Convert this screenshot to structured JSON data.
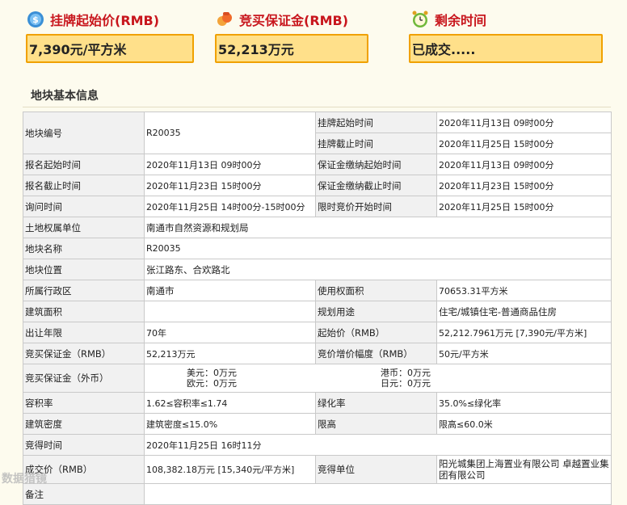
{
  "header": {
    "start_price_label": "挂牌起始价(RMB)",
    "deposit_label": "竞买保证金(RMB)",
    "time_left_label": "剩余时间",
    "start_price_value": "7,390元/平方米",
    "deposit_value": "52,213万元",
    "time_left_value": "已成交....."
  },
  "section": {
    "title": "地块基本信息"
  },
  "table": {
    "r1": {
      "k1": "地块编号",
      "v1": "R20035",
      "k2a": "挂牌起始时间",
      "v2a": "2020年11月13日 09时00分",
      "k2b": "挂牌截止时间",
      "v2b": "2020年11月25日 15时00分"
    },
    "r2": {
      "k1": "报名起始时间",
      "v1": "2020年11月13日 09时00分",
      "k2": "保证金缴纳起始时间",
      "v2": "2020年11月13日 09时00分"
    },
    "r3": {
      "k1": "报名截止时间",
      "v1": "2020年11月23日 15时00分",
      "k2": "保证金缴纳截止时间",
      "v2": "2020年11月23日 15时00分"
    },
    "r4": {
      "k1": "询问时间",
      "v1": "2020年11月25日 14时00分-15时00分",
      "k2": "限时竞价开始时间",
      "v2": "2020年11月25日 15时00分"
    },
    "r5": {
      "k1": "土地权属单位",
      "v1": "南通市自然资源和规划局"
    },
    "r6": {
      "k1": "地块名称",
      "v1": "R20035"
    },
    "r7": {
      "k1": "地块位置",
      "v1": "张江路东、合欢路北"
    },
    "r8": {
      "k1": "所属行政区",
      "v1": "南通市",
      "k2": "使用权面积",
      "v2": "70653.31平方米"
    },
    "r9": {
      "k1": "建筑面积",
      "v1": "",
      "k2": "规划用途",
      "v2": "住宅/城镇住宅-普通商品住房"
    },
    "r10": {
      "k1": "出让年限",
      "v1": "70年",
      "k2": "起始价（RMB）",
      "v2": "52,212.7961万元 [7,390元/平方米]"
    },
    "r11": {
      "k1": "竞买保证金（RMB）",
      "v1": "52,213万元",
      "k2": "竞价增价幅度（RMB）",
      "v2": "50元/平方米"
    },
    "r12": {
      "k1": "竞买保证金（外币）",
      "usd": "美元：0万元",
      "eur": "欧元：0万元",
      "hkd": "港币：0万元",
      "jpy": "日元：0万元"
    },
    "r13": {
      "k1": "容积率",
      "v1": "1.62≤容积率≤1.74",
      "k2": "绿化率",
      "v2": "35.0%≤绿化率"
    },
    "r14": {
      "k1": "建筑密度",
      "v1": "建筑密度≤15.0%",
      "k2": "限高",
      "v2": "限高≤60.0米"
    },
    "r15": {
      "k1": "竞得时间",
      "v1": "2020年11月25日 16时11分"
    },
    "r16": {
      "k1": "成交价（RMB）",
      "v1": "108,382.18万元 [15,340元/平方米]",
      "k2": "竞得单位",
      "v2": "阳光城集团上海置业有限公司 卓越置业集团有限公司"
    },
    "r17": {
      "k1": "备注"
    }
  },
  "watermark": "数据猎镜"
}
